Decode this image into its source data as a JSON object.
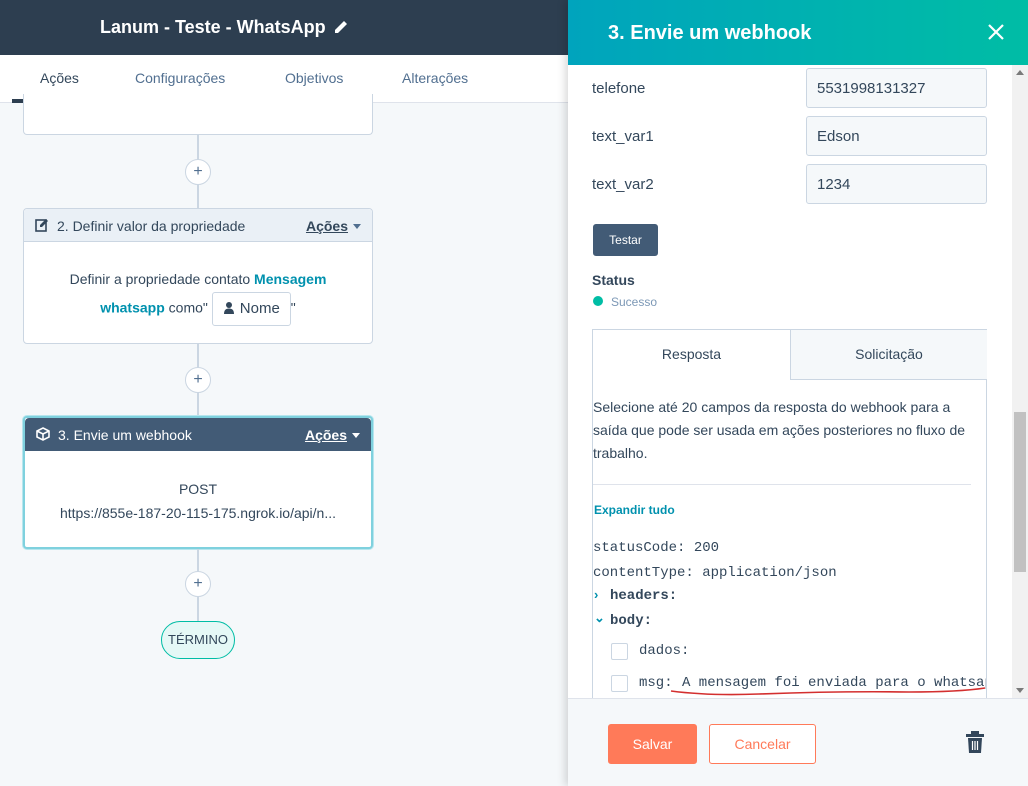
{
  "header": {
    "title": "Lanum - Teste - WhatsApp"
  },
  "tabs": [
    {
      "label": "Ações",
      "active": true
    },
    {
      "label": "Configurações"
    },
    {
      "label": "Objetivos"
    },
    {
      "label": "Alterações"
    }
  ],
  "workflow": {
    "step2": {
      "title": "2. Definir valor da propriedade",
      "actions_label": "Ações",
      "text_prefix": "Definir a propriedade contato",
      "property_part1": "Mensagem",
      "property_part2": "whatsapp",
      "text_como": "como",
      "quote_open": "\"",
      "quote_close": "\"",
      "token_label": "Nome"
    },
    "step3": {
      "title": "3. Envie um webhook",
      "actions_label": "Ações",
      "method": "POST",
      "url": "https://855e-187-20-115-175.ngrok.io/api/n..."
    },
    "end_label": "TÉRMINO",
    "plus": "+"
  },
  "panel": {
    "title": "3. Envie um webhook",
    "fields": [
      {
        "label": "telefone",
        "value": "5531998131327"
      },
      {
        "label": "text_var1",
        "value": "Edson"
      },
      {
        "label": "text_var2",
        "value": "1234"
      }
    ],
    "test_button": "Testar",
    "status_label": "Status",
    "status_value": "Sucesso",
    "response_tabs": [
      "Resposta",
      "Solicitação"
    ],
    "description": "Selecione até 20 campos da resposta do webhook para a saída que pode ser usada em ações posteriores no fluxo de trabalho.",
    "expand_all": "Expandir tudo",
    "response": {
      "statusCode": "statusCode: 200",
      "contentType": "contentType: application/json",
      "headers": "headers:",
      "body": "body:",
      "dados": "dados:",
      "msg_key": "msg:",
      "msg_value": "A mensagem foi enviada para o whatsap"
    },
    "save": "Salvar",
    "cancel": "Cancelar"
  },
  "colors": {
    "accent": "#00a4bd",
    "primary_button": "#ff7a59",
    "success": "#00bda5",
    "dark": "#2d3e50"
  }
}
